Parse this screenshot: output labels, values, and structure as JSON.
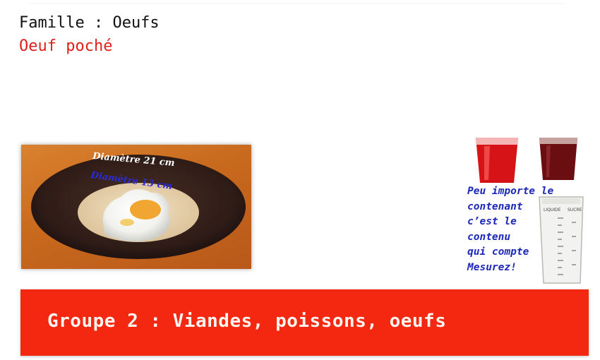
{
  "header": {
    "family_line": "Famille : Oeufs",
    "recipe_title": "Oeuf poché"
  },
  "photo": {
    "label_outer": "Diamètre 21 cm",
    "label_inner": "Diamètre 13 cm"
  },
  "measure": {
    "lines": [
      "Peu importe le",
      "contenant",
      "c’est le",
      "contenu",
      "qui compte",
      "Mesurez!"
    ],
    "jug_labels": [
      "LIQUIDE",
      "SUCRE"
    ]
  },
  "banner": {
    "title": "Groupe 2 : Viandes, poissons, oeufs"
  },
  "colors": {
    "recipe_red": "#e0201a",
    "banner_red": "#f42810",
    "note_blue": "#1d28b8"
  }
}
